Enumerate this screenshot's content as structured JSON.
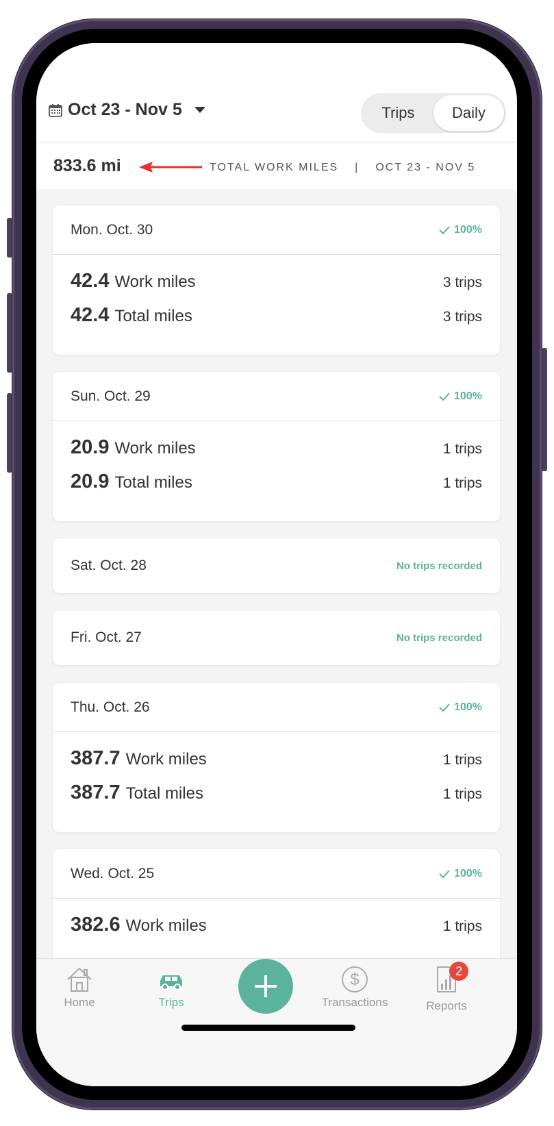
{
  "header": {
    "date_range": "Oct 23 - Nov 5",
    "segments": [
      {
        "label": "Trips",
        "active": false
      },
      {
        "label": "Daily",
        "active": true
      }
    ]
  },
  "summary": {
    "total": "833.6 mi",
    "caption": "TOTAL WORK MILES",
    "separator": "|",
    "period": "OCT 23 - NOV 5"
  },
  "days": [
    {
      "day": "Mon. Oct. 30",
      "status": "100%",
      "work": "42.4",
      "work_label": "Work miles",
      "total": "42.4",
      "total_label": "Total miles",
      "work_trips": "3 trips",
      "total_trips": "3 trips"
    },
    {
      "day": "Sun. Oct. 29",
      "status": "100%",
      "work": "20.9",
      "work_label": "Work miles",
      "total": "20.9",
      "total_label": "Total miles",
      "work_trips": "1 trips",
      "total_trips": "1 trips"
    },
    {
      "day": "Sat. Oct. 28",
      "status": "No trips recorded"
    },
    {
      "day": "Fri. Oct. 27",
      "status": "No trips recorded"
    },
    {
      "day": "Thu. Oct. 26",
      "status": "100%",
      "work": "387.7",
      "work_label": "Work miles",
      "total": "387.7",
      "total_label": "Total miles",
      "work_trips": "1 trips",
      "total_trips": "1 trips"
    },
    {
      "day": "Wed. Oct. 25",
      "status": "100%",
      "work": "382.6",
      "work_label": "Work miles",
      "work_trips": "1 trips"
    }
  ],
  "tabs": [
    {
      "label": "Home",
      "icon": "home-icon"
    },
    {
      "label": "Trips",
      "icon": "car-icon",
      "active": true
    },
    {
      "label": "Transactions",
      "icon": "dollar-icon"
    },
    {
      "label": "Reports",
      "icon": "reports-icon",
      "badge": "2"
    }
  ],
  "colors": {
    "accent": "#5bb39c",
    "badge": "#e8453c",
    "arrow": "#e8302a"
  }
}
